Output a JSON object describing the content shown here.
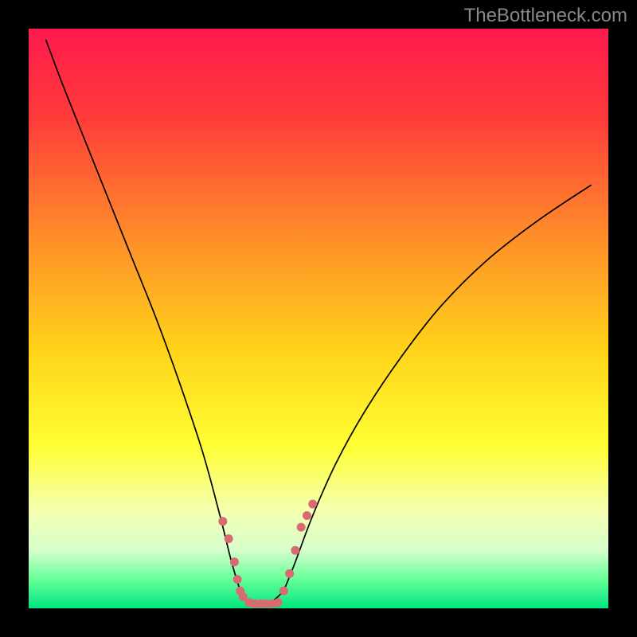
{
  "watermark": "TheBottleneck.com",
  "chart_data": {
    "type": "line",
    "title": "",
    "xlabel": "",
    "ylabel": "",
    "xlim": [
      0,
      100
    ],
    "ylim": [
      0,
      100
    ],
    "background": {
      "type": "vertical_gradient",
      "stops": [
        {
          "offset": 0.0,
          "color": "#ff1a4d"
        },
        {
          "offset": 0.15,
          "color": "#ff3a3a"
        },
        {
          "offset": 0.35,
          "color": "#ff8a2a"
        },
        {
          "offset": 0.55,
          "color": "#ffd21a"
        },
        {
          "offset": 0.72,
          "color": "#ffff33"
        },
        {
          "offset": 0.83,
          "color": "#f5ffb0"
        },
        {
          "offset": 0.9,
          "color": "#d6ffcc"
        },
        {
          "offset": 0.95,
          "color": "#66ff99"
        },
        {
          "offset": 1.0,
          "color": "#00e680"
        }
      ]
    },
    "series": [
      {
        "name": "left_curve",
        "x": [
          3,
          6,
          10,
          14,
          18,
          22,
          26,
          30,
          33,
          35,
          36.5
        ],
        "y": [
          98,
          90,
          80,
          70,
          60,
          50,
          39,
          27,
          16,
          8,
          3
        ],
        "stroke": "#000000",
        "stroke_width": 1.7
      },
      {
        "name": "right_curve",
        "x": [
          44,
          46,
          49,
          53,
          58,
          64,
          71,
          79,
          88,
          97
        ],
        "y": [
          3,
          8,
          16,
          25,
          34,
          43,
          52,
          60,
          67,
          73
        ],
        "stroke": "#000000",
        "stroke_width": 1.7
      },
      {
        "name": "bottom_fill",
        "x": [
          36.5,
          38,
          40,
          42,
          44
        ],
        "y": [
          3,
          1.2,
          0.8,
          1.2,
          3
        ],
        "stroke": "#000000",
        "stroke_width": 1.7
      }
    ],
    "markers": [
      {
        "name": "left_dots",
        "x": [
          33.5,
          34.5,
          35.5,
          36,
          36.5,
          37,
          38
        ],
        "y": [
          15,
          12,
          8,
          5,
          3,
          2,
          1
        ],
        "color": "#d86b72",
        "size": 11
      },
      {
        "name": "bottom_dots",
        "x": [
          39,
          40,
          41,
          42,
          43
        ],
        "y": [
          0.8,
          0.8,
          0.8,
          0.8,
          1
        ],
        "color": "#d86b72",
        "size": 11
      },
      {
        "name": "right_dots",
        "x": [
          44,
          45,
          46,
          47,
          48,
          49
        ],
        "y": [
          3,
          6,
          10,
          14,
          16,
          18
        ],
        "color": "#d86b72",
        "size": 11
      }
    ],
    "frame": {
      "color": "#000000",
      "thickness_px": 36
    }
  }
}
